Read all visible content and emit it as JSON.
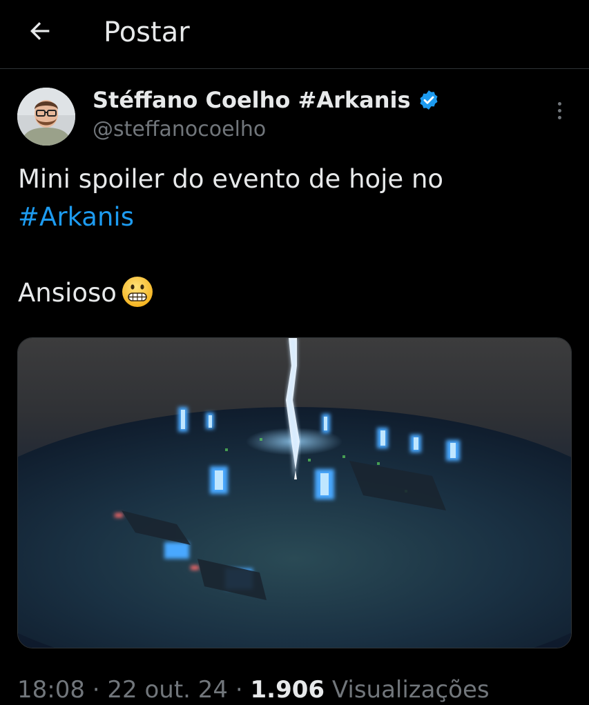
{
  "header": {
    "title": "Postar",
    "back_icon": "arrow-left-icon"
  },
  "post": {
    "author": {
      "display_name": "Stéffano Coelho #Arkanis",
      "handle": "@steffanocoelho",
      "verified_icon": "verified-badge-icon",
      "verified_color": "#1d9bf0"
    },
    "more_icon": "more-vertical-icon",
    "text": {
      "line1": "Mini spoiler do evento de hoje no",
      "hashtag": "#Arkanis",
      "line3": "Ansioso",
      "emoji": "grimacing-face-emoji"
    },
    "media": {
      "type": "image",
      "subject": "night-game-scene-with-lightning"
    },
    "meta": {
      "time": "18:08",
      "sep1": " · ",
      "date": "22 out. 24",
      "sep2": " · ",
      "views_count": "1.906",
      "views_label": " Visualizações"
    }
  },
  "colors": {
    "background": "#000000",
    "text": "#e7e9ea",
    "secondary": "#71767b",
    "accent": "#1d9bf0",
    "divider": "#2f3336"
  }
}
